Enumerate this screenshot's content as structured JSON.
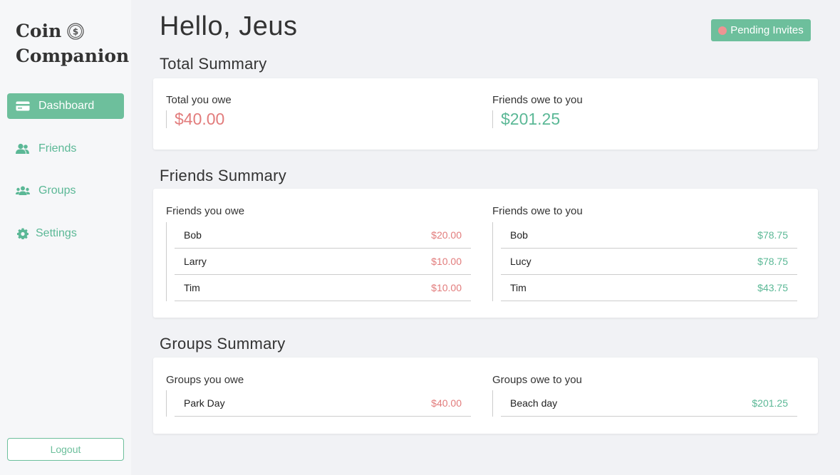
{
  "app": {
    "logo_line1": "Coin",
    "logo_line2": "Companion"
  },
  "sidebar": {
    "items": [
      {
        "label": "Dashboard",
        "icon": "card-icon",
        "active": true
      },
      {
        "label": "Friends",
        "icon": "user-icon"
      },
      {
        "label": "Groups",
        "icon": "users-icon"
      },
      {
        "label": "Settings",
        "icon": "gear-icon"
      }
    ],
    "logout_label": "Logout"
  },
  "header": {
    "greeting": "Hello, Jeus",
    "pending_invites_label": "Pending Invites"
  },
  "colors": {
    "accent": "#6dbf9c",
    "owe": "#e27c7c",
    "owed": "#5bb896",
    "badge_dot": "#ee9493"
  },
  "total_summary": {
    "title": "Total Summary",
    "you_owe_label": "Total you owe",
    "you_owe_amount": "$40.00",
    "owed_label": "Friends owe to you",
    "owed_amount": "$201.25"
  },
  "friends_summary": {
    "title": "Friends Summary",
    "you_owe_label": "Friends you owe",
    "you_owe": [
      {
        "name": "Bob",
        "amount": "$20.00"
      },
      {
        "name": "Larry",
        "amount": "$10.00"
      },
      {
        "name": "Tim",
        "amount": "$10.00"
      }
    ],
    "owed_label": "Friends owe to you",
    "owed": [
      {
        "name": "Bob",
        "amount": "$78.75"
      },
      {
        "name": "Lucy",
        "amount": "$78.75"
      },
      {
        "name": "Tim",
        "amount": "$43.75"
      }
    ]
  },
  "groups_summary": {
    "title": "Groups Summary",
    "you_owe_label": "Groups you owe",
    "you_owe": [
      {
        "name": "Park Day",
        "amount": "$40.00"
      }
    ],
    "owed_label": "Groups owe to you",
    "owed": [
      {
        "name": "Beach day",
        "amount": "$201.25"
      }
    ]
  }
}
